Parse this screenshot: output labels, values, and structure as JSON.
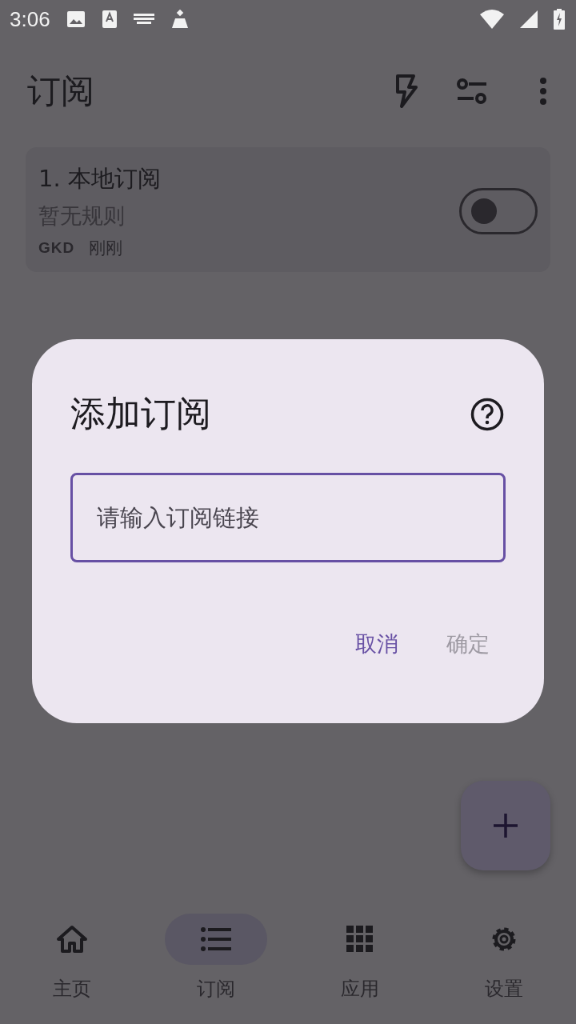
{
  "status_bar": {
    "time": "3:06"
  },
  "app_bar": {
    "title": "订阅"
  },
  "subscriptions": [
    {
      "title": "1. 本地订阅",
      "subtitle": "暂无规则",
      "author": "GKD",
      "updated": "刚刚",
      "on": false
    }
  ],
  "dialog": {
    "title": "添加订阅",
    "field": {
      "placeholder": "请输入订阅链接"
    },
    "buttons": [
      {
        "label": "取消",
        "disabled": false
      },
      {
        "label": "确定",
        "disabled": true
      }
    ]
  },
  "nav": [
    {
      "label": "主页",
      "selected": false
    },
    {
      "label": "订阅",
      "selected": true
    },
    {
      "label": "应用",
      "selected": false
    },
    {
      "label": "设置",
      "selected": false
    }
  ]
}
